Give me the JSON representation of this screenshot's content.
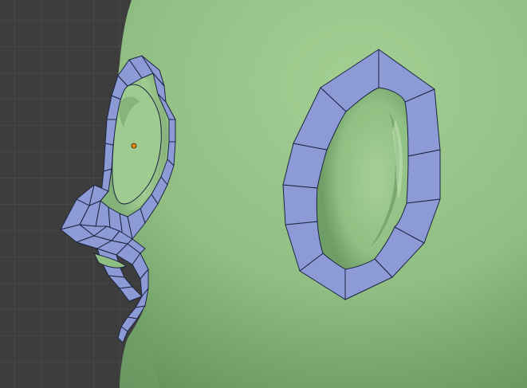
{
  "viewport": {
    "background_color": "#3d3d3d",
    "grid_line_color": "#4e4e4e",
    "grid_visible": true,
    "mesh_base_color": "#9bc88e",
    "mesh_shadow_color": "#5f8f58",
    "selected_face_color": "#8c9bd6",
    "selected_edge_color": "#1d2340",
    "origin_dot_color": "#f28a14",
    "origin_visible": true
  }
}
